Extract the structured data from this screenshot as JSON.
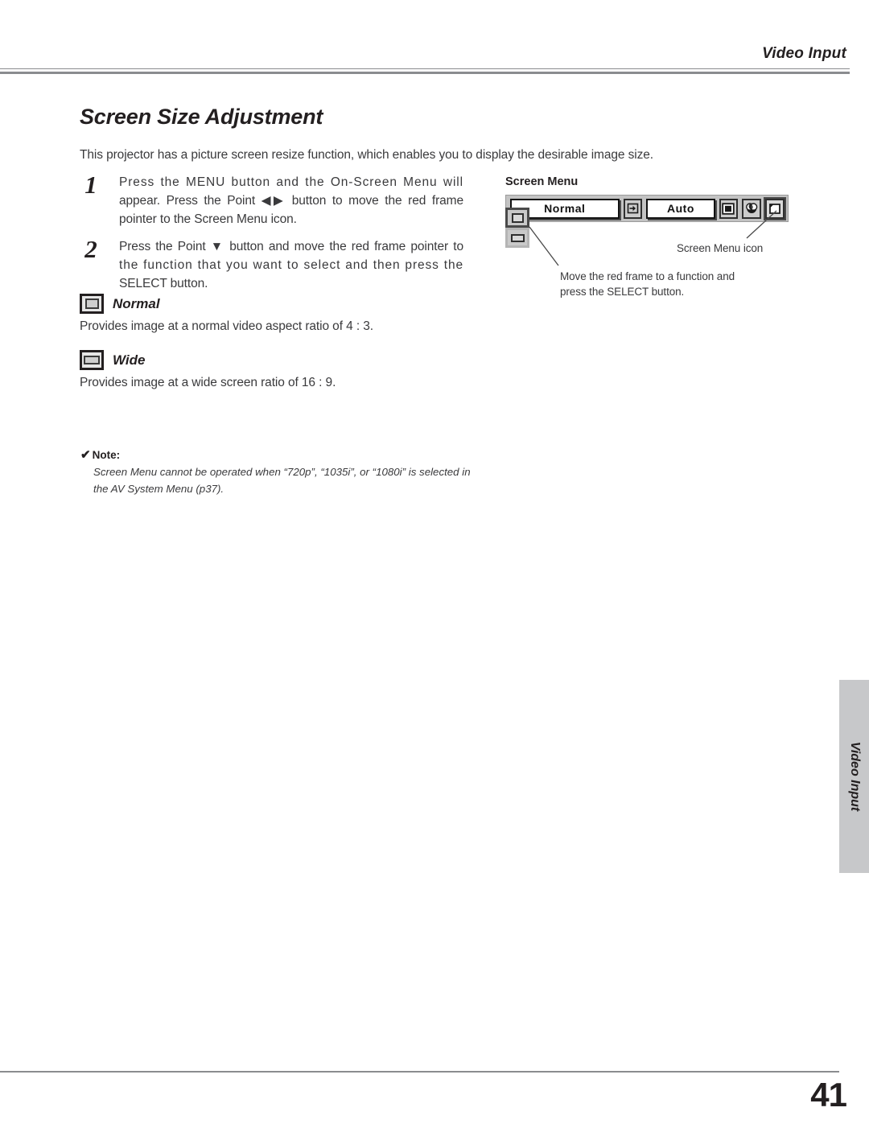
{
  "header": {
    "section_title": "Video Input"
  },
  "page": {
    "title": "Screen Size Adjustment",
    "intro": "This projector has a picture screen resize function, which enables you to display the desirable image size.",
    "number": "41"
  },
  "steps": [
    {
      "number": "1",
      "line1": "Press the MENU button and the On-Screen Menu will",
      "line2_a": "appear.  Press the Point ",
      "line2_arrows": "◀▶",
      "line2_b": " button to move the red frame",
      "line3": "pointer to the Screen Menu icon."
    },
    {
      "number": "2",
      "line1_a": "Press the Point ",
      "line1_arrow": "▼",
      "line1_b": " button and move the red frame pointer to",
      "line2": "the function that you want to select and then press the",
      "line3": "SELECT button."
    }
  ],
  "modes": [
    {
      "icon": "aspect-4-3-icon",
      "label": "Normal",
      "description": "Provides image at a normal video aspect ratio of 4 : 3."
    },
    {
      "icon": "aspect-16-9-icon",
      "label": "Wide",
      "description": "Provides image at a wide screen ratio of 16 : 9."
    }
  ],
  "note": {
    "check": "✔",
    "heading": "Note:",
    "line1": "Screen Menu cannot be operated when “720p”, “1035i”, or “1080i” is selected in the",
    "line2": "AV System Menu (p37)."
  },
  "illustration": {
    "title": "Screen Menu",
    "menu_bar": {
      "status_field": "Normal",
      "input_icon": "input-arrow-icon",
      "source_field": "Auto",
      "icons": [
        {
          "name": "image-adjust-icon",
          "selected": false
        },
        {
          "name": "color-palette-icon",
          "selected": false
        },
        {
          "name": "screen-menu-icon",
          "selected": true
        }
      ]
    },
    "sub_icons": [
      {
        "name": "aspect-4-3-icon",
        "framed": true
      },
      {
        "name": "aspect-16-9-icon",
        "framed": false
      }
    ],
    "callouts": {
      "screen_menu_icon": "Screen Menu icon",
      "move_frame_line1": "Move the red frame to a function and",
      "move_frame_line2": "press the SELECT button."
    }
  },
  "side_tab": {
    "label": "Video Input"
  }
}
